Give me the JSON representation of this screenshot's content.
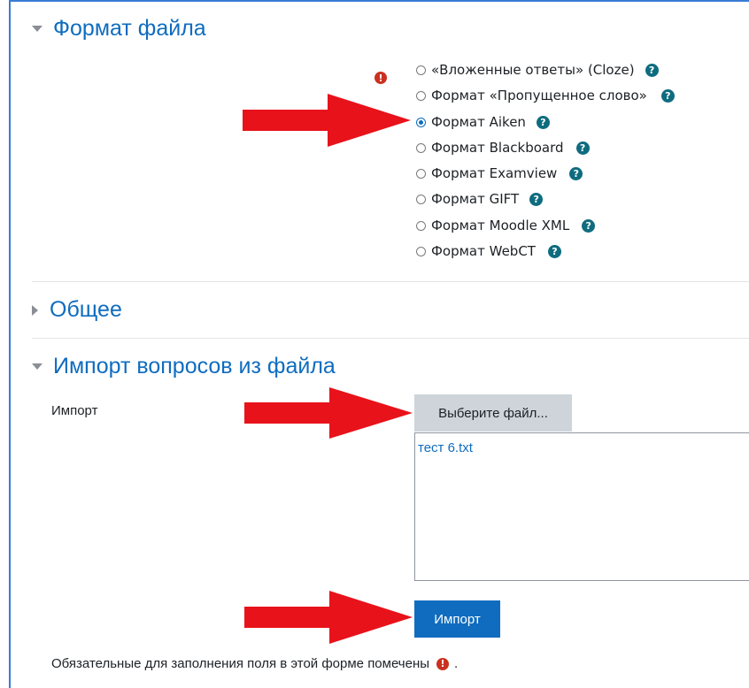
{
  "sections": {
    "file_format": {
      "title": "Формат файла",
      "options": [
        {
          "label": "«Вложенные ответы» (Cloze)",
          "checked": false
        },
        {
          "label": "Формат «Пропущенное слово»",
          "checked": false
        },
        {
          "label": "Формат Aiken",
          "checked": true
        },
        {
          "label": "Формат Blackboard",
          "checked": false
        },
        {
          "label": "Формат Examview",
          "checked": false
        },
        {
          "label": "Формат GIFT",
          "checked": false
        },
        {
          "label": "Формат Moodle XML",
          "checked": false
        },
        {
          "label": "Формат WebCT",
          "checked": false
        }
      ]
    },
    "general": {
      "title": "Общее"
    },
    "import_file": {
      "title": "Импорт вопросов из файла",
      "field_label": "Импорт",
      "choose_button": "Выберите файл...",
      "file_name": "тест 6.txt",
      "submit_button": "Импорт"
    }
  },
  "footer": {
    "required_note": "Обязательные для заполнения поля в этой форме помечены",
    "required_suffix": "."
  },
  "icons": {
    "required": "exclamation-circle-icon",
    "help": "question-circle-icon",
    "arrow": "red-arrow-right-icon"
  },
  "colors": {
    "link_blue": "#0f6cbf",
    "required_red": "#ca3120",
    "help_teal": "#0f6c7f",
    "arrow_red": "#e8121b"
  }
}
